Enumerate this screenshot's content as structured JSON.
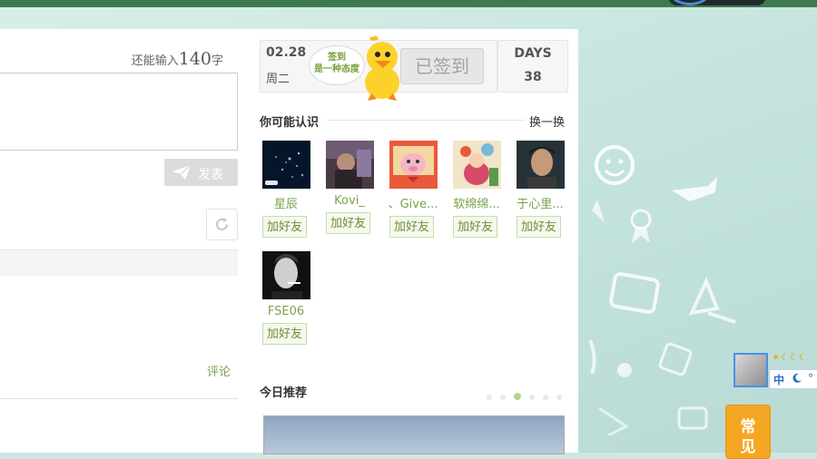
{
  "composer": {
    "counter_prefix": "还能输入",
    "counter_num": "140",
    "counter_suffix": "字",
    "post_label": "发表",
    "comment_link": "评论"
  },
  "checkin": {
    "date": "02.28",
    "weekday": "周二",
    "bubble_line1": "签到",
    "bubble_line2": "是一种态度",
    "signed_label": "已签到",
    "days_label": "DAYS",
    "days_value": "38"
  },
  "people": {
    "title": "你可能认识",
    "refresh_label": "换一换",
    "add_label": "加好友",
    "items": [
      {
        "name": "星辰",
        "avatar": "starry-night-avatar"
      },
      {
        "name": "Kovi_",
        "avatar": "dim-room-avatar"
      },
      {
        "name": "、Give...",
        "avatar": "cartoon-pig-avatar"
      },
      {
        "name": "软绵绵...",
        "avatar": "colorful-doll-avatar"
      },
      {
        "name": "于心里...",
        "avatar": "young-man-avatar"
      },
      {
        "name": "FSE06",
        "avatar": "smoking-man-bw-avatar"
      }
    ]
  },
  "recommend": {
    "title": "今日推荐",
    "dot_count": 6,
    "active_dot": 2
  },
  "floating": {
    "status_icons": "☀☾☾☾",
    "ime_label": "中",
    "moon_icon": "moon-icon",
    "faq_line1": "常",
    "faq_line2": "见"
  },
  "colors": {
    "accent_green": "#7aa14a",
    "top_bar": "#3e7a4f",
    "faq_orange": "#f5a623"
  }
}
